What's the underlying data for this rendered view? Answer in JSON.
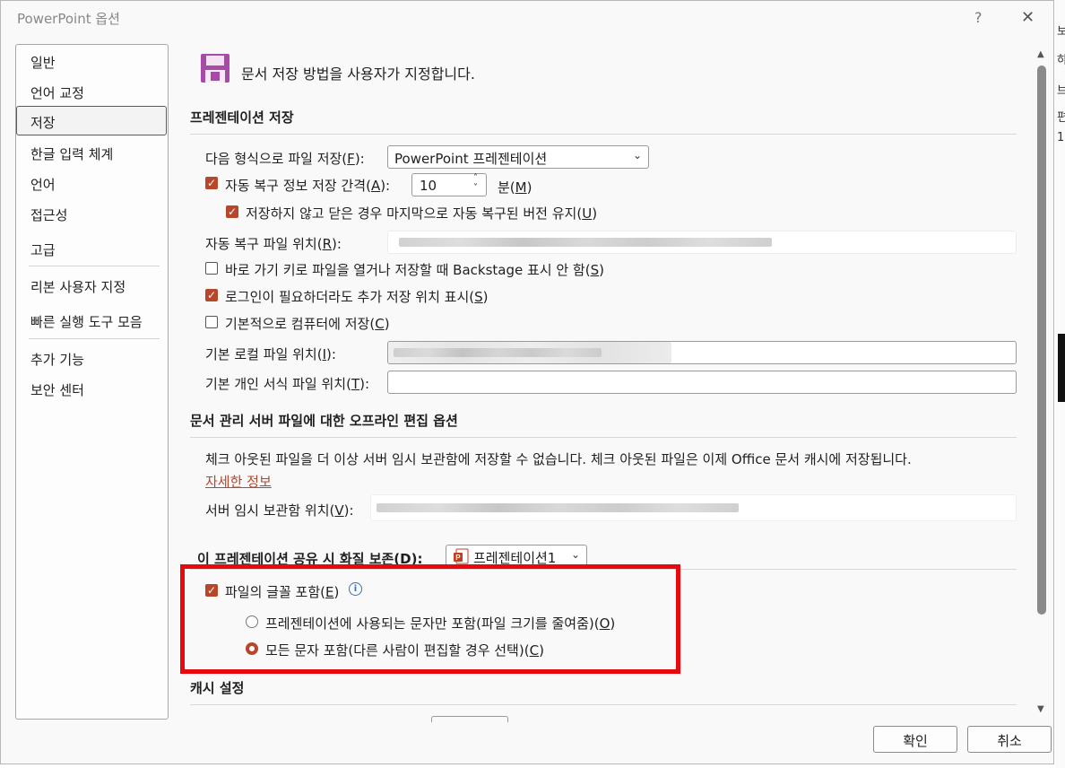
{
  "window": {
    "title": "PowerPoint 옵션",
    "help_glyph": "?",
    "close_glyph": "✕"
  },
  "sidebar": {
    "items": [
      {
        "label": "일반"
      },
      {
        "label": "언어 교정"
      },
      {
        "label": "저장"
      },
      {
        "label": "한글 입력 체계"
      },
      {
        "label": "언어"
      },
      {
        "label": "접근성"
      },
      {
        "label": "고급"
      },
      {
        "label": "리본 사용자 지정"
      },
      {
        "label": "빠른 실행 도구 모음"
      },
      {
        "label": "추가 기능"
      },
      {
        "label": "보안 센터"
      }
    ],
    "selected": "저장"
  },
  "main": {
    "heading": "문서 저장 방법을 사용자가 지정합니다.",
    "save_section": {
      "title": "프레젠테이션 저장",
      "format_label": "다음 형식으로 파일 저장(",
      "format_key": "F",
      "format_value": "PowerPoint 프레젠테이션",
      "autorecover_label": "자동 복구 정보 저장 간격(",
      "autorecover_key": "A",
      "autorecover_checked": true,
      "autorecover_minutes": "10",
      "minutes_label": "분(",
      "minutes_key": "M",
      "keep_last_label": "저장하지 않고 닫은 경우 마지막으로 자동 복구된 버전 유지(",
      "keep_last_key": "U",
      "keep_last_checked": true,
      "autorecover_location_label": "자동 복구 파일 위치(",
      "autorecover_location_key": "R",
      "backstage_label": "바로 가기 키로 파일을 열거나 저장할 때 Backstage 표시 안 함(",
      "backstage_key": "S",
      "backstage_checked": false,
      "signin_label": "로그인이 필요하더라도 추가 저장 위치 표시(",
      "signin_key": "S",
      "signin_checked": true,
      "default_computer_label": "기본적으로 컴퓨터에 저장(",
      "default_computer_key": "C",
      "default_computer_checked": false,
      "local_location_label": "기본 로컬 파일 위치(",
      "local_location_key": "I",
      "template_location_label": "기본 개인 서식 파일 위치(",
      "template_location_key": "T"
    },
    "offline_section": {
      "title": "문서 관리 서버 파일에 대한 오프라인 편집 옵션",
      "notice": "체크 아웃된 파일을 더 이상 서버 임시 보관함에 저장할 수 없습니다. 체크 아웃된 파일은 이제 Office 문서 캐시에 저장됩니다.",
      "learn_more": "자세한 정보",
      "drafts_label": "서버 임시 보관함 위치(",
      "drafts_key": "V"
    },
    "fidelity_section": {
      "title": "이 프레젠테이션 공유 시 화질 보존(D):",
      "presentation_value": "프레젠테이션1",
      "embed_fonts_label": "파일의 글꼴 포함(",
      "embed_fonts_key": "E",
      "embed_fonts_checked": true,
      "embed_used_label": "프레젠테이션에 사용되는 문자만 포함(파일 크기를 줄여줌)(",
      "embed_used_key": "O",
      "embed_used_selected": false,
      "embed_all_label": "모든 문자 포함(다른 사람이 편집할 경우 선택)(",
      "embed_all_key": "C",
      "embed_all_selected": true
    },
    "cache_section": {
      "title": "캐시 설정"
    }
  },
  "footer": {
    "ok_label": "확인",
    "cancel_label": "취소"
  },
  "backdrop": {
    "fragments": [
      "보",
      "하",
      "브",
      "편",
      "1"
    ]
  },
  "colors": {
    "accent": "#b7472a",
    "highlight_box": "#e8090f",
    "save_icon": "#a64ca6"
  },
  "icons": {
    "save": "floppy-disk-icon",
    "info": "info-icon",
    "powerpoint": "powerpoint-file-icon"
  }
}
